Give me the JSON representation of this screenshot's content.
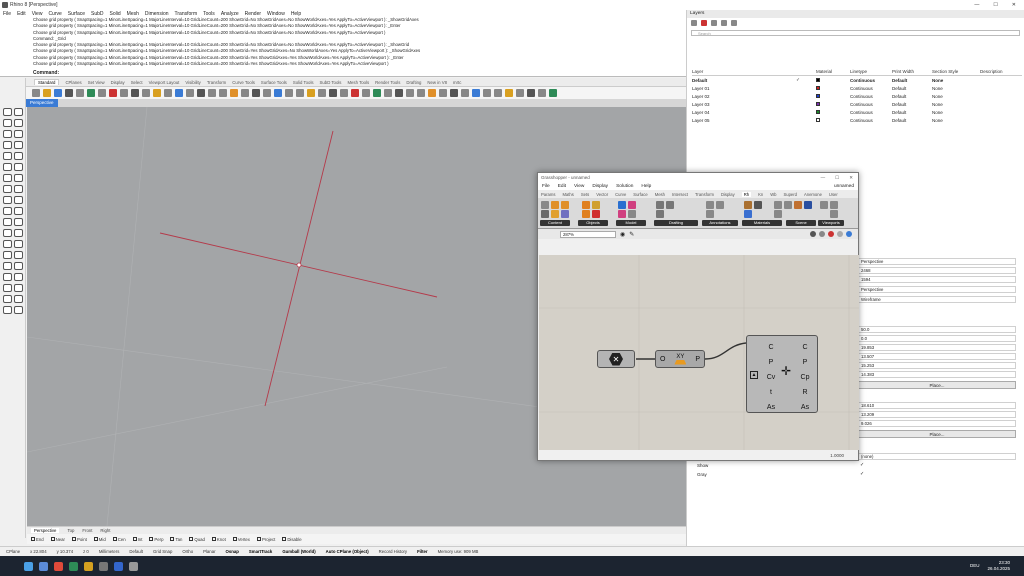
{
  "window": {
    "title": "Rhino 8 [Perspective]"
  },
  "menu": [
    "File",
    "Edit",
    "View",
    "Curve",
    "Surface",
    "SubD",
    "Solid",
    "Mesh",
    "Dimension",
    "Transform",
    "Tools",
    "Analyze",
    "Render",
    "Window",
    "Help"
  ],
  "command_history": [
    "Choose grid property ( SnapSpacing=1  MinorLineSpacing=1  MajorLineInterval=10  GridLineCount=200  ShowGrid=No  ShowGridAxes=No  ShowWorldAxes=Yes  ApplyTo=ActiveViewport ): _ShowGridAxes",
    "Choose grid property ( SnapSpacing=1  MinorLineSpacing=1  MajorLineInterval=10  GridLineCount=200  ShowGrid=No  ShowGridAxes=No  ShowWorldAxes=Yes  ApplyTo=ActiveViewport ): _Enter",
    "Choose grid property ( SnapSpacing=1  MinorLineSpacing=1  MajorLineInterval=10  GridLineCount=200  ShowGrid=No  ShowGridAxes=No  ShowWorldAxes=Yes  ApplyTo=ActiveViewport )",
    "Command: _Grid",
    "Choose grid property ( SnapSpacing=1  MinorLineSpacing=1  MajorLineInterval=10  GridLineCount=200  ShowGrid=No  ShowGridAxes=No  ShowWorldAxes=Yes  ApplyTo=ActiveViewport ): _ShowGrid",
    "Choose grid property ( SnapSpacing=1  MinorLineSpacing=1  MajorLineInterval=10  GridLineCount=200  ShowGrid=Yes  ShowGridAxes=No  ShowWorldAxes=Yes  ApplyTo=ActiveViewport ): _ShowGridAxes",
    "Choose grid property ( SnapSpacing=1  MinorLineSpacing=1  MajorLineInterval=10  GridLineCount=200  ShowGrid=Yes  ShowGridAxes=Yes  ShowWorldAxes=Yes  ApplyTo=ActiveViewport ): _Enter",
    "Choose grid property ( SnapSpacing=1  MinorLineSpacing=1  MajorLineInterval=10  GridLineCount=200  ShowGrid=Yes  ShowGridAxes=Yes  ShowWorldAxes=Yes  ApplyTo=ActiveViewport )"
  ],
  "command_prompt": "Command:",
  "toolbar_tabs": [
    "Standard",
    "CPlanes",
    "Set View",
    "Display",
    "Select",
    "Viewport Layout",
    "Visibility",
    "Transform",
    "Curve Tools",
    "Surface Tools",
    "Solid Tools",
    "SubD Tools",
    "Mesh Tools",
    "Render Tools",
    "Drafting",
    "New in V8",
    "mrtc"
  ],
  "viewport": {
    "label": "Perspective"
  },
  "viewport_tabs": [
    "Perspective",
    "Top",
    "Front",
    "Right"
  ],
  "osnaps": [
    "End",
    "Near",
    "Point",
    "Mid",
    "Cen",
    "Int",
    "Perp",
    "Tan",
    "Quad",
    "Knot",
    "Vertex",
    "Project",
    "Disable"
  ],
  "status": {
    "cplane": "CPlane",
    "x": "x 22.804",
    "y": "y 10.374",
    "z": "z 0",
    "units": "Millimeters",
    "layer": "Default",
    "grid_snap": "Grid Snap",
    "ortho": "Ortho",
    "planar": "Planar",
    "osnap": "Osnap",
    "smarttrack": "SmartTrack",
    "gumball": "Gumball (World)",
    "autocplane": "Auto CPlane (Object)",
    "record": "Record History",
    "filter": "Filter",
    "memory": "Memory use: 909 MB"
  },
  "taskbar": {
    "lang": "DEU",
    "time": "23:30",
    "date": "26.04.2025"
  },
  "layers": {
    "title": "Layers",
    "search_placeholder": "Search",
    "columns": [
      "Layer",
      "Material",
      "Linetype",
      "Print Width",
      "Section Style",
      "Description"
    ],
    "rows": [
      {
        "name": "Default",
        "linetype": "Continuous",
        "width": "Default",
        "section": "None",
        "color": "#000000",
        "current": true
      },
      {
        "name": "Layer 01",
        "linetype": "Continuous",
        "width": "Default",
        "section": "None",
        "color": "#d02020"
      },
      {
        "name": "Layer 02",
        "linetype": "Continuous",
        "width": "Default",
        "section": "None",
        "color": "#2040d0"
      },
      {
        "name": "Layer 03",
        "linetype": "Continuous",
        "width": "Default",
        "section": "None",
        "color": "#7a2fb0"
      },
      {
        "name": "Layer 04",
        "linetype": "Continuous",
        "width": "Default",
        "section": "None",
        "color": "#1a8a2a"
      },
      {
        "name": "Layer 05",
        "linetype": "Continuous",
        "width": "Default",
        "section": "None",
        "color": "#ffffff"
      }
    ]
  },
  "properties": {
    "view_fields": [
      "Perspective",
      "2468",
      "1594",
      "Perspective",
      "Wireframe"
    ],
    "camera_fields": [
      "50.0",
      "0.0",
      "19.853",
      "13.507",
      "15.253",
      "14.383"
    ],
    "place1": "Place...",
    "target_fields": [
      "18.610",
      "13.209",
      "9.026"
    ],
    "place2": "Place...",
    "bg": "(none)",
    "show": "Show",
    "gray": "Gray"
  },
  "grasshopper": {
    "title": "Grasshopper - unnamed",
    "menu": [
      "File",
      "Edit",
      "View",
      "Display",
      "Solution",
      "Help"
    ],
    "doc": "unnamed",
    "tabs": [
      "Params",
      "Maths",
      "Sets",
      "Vector",
      "Curve",
      "Surface",
      "Mesh",
      "Intersect",
      "Transform",
      "Display",
      "Rh",
      "Kn",
      "Wb",
      "Superd",
      "Anemone",
      "User"
    ],
    "categories": [
      "Content",
      "Objects",
      "Model",
      "Drafting",
      "Annotations",
      "Materials",
      "Scene",
      "Viewports"
    ],
    "zoom": "287%",
    "comp1": {
      "out": ""
    },
    "comp2": {
      "in": "O",
      "label": "XY",
      "out": "P"
    },
    "comp3": {
      "inputs": [
        "C",
        "P",
        "Cv",
        "t",
        "As"
      ],
      "outputs": [
        "C",
        "P",
        "Cp",
        "R",
        "As"
      ]
    },
    "status": "1.0000"
  }
}
